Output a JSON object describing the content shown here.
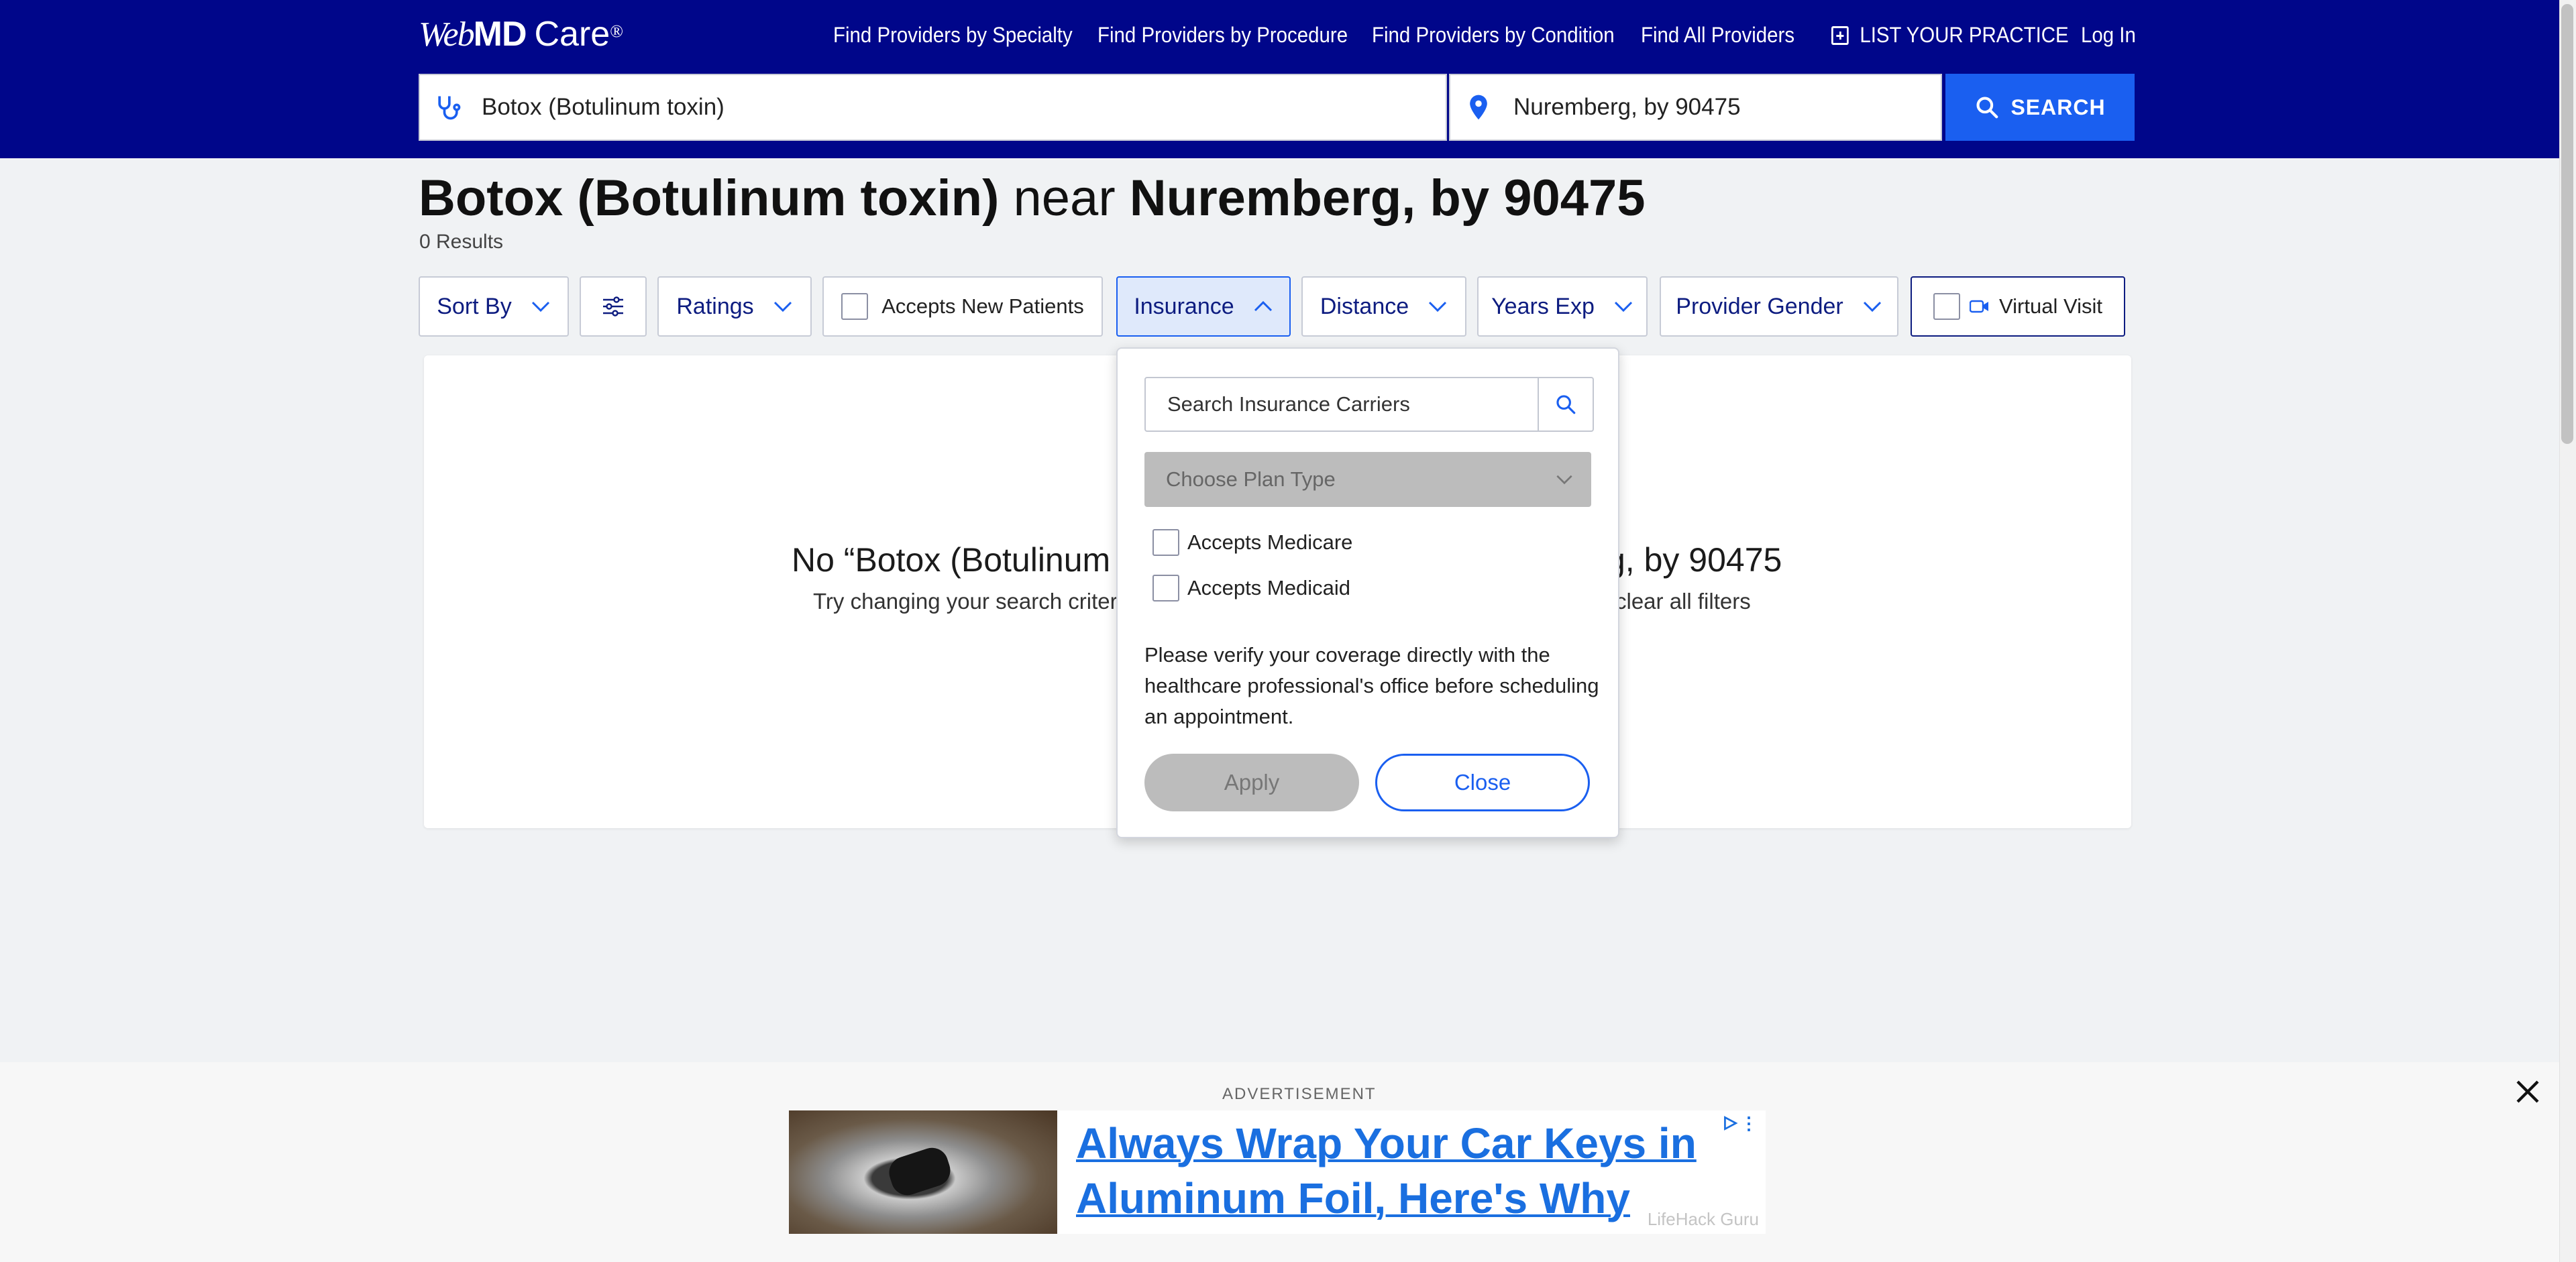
{
  "header": {
    "logo": {
      "web": "Web",
      "md": "MD",
      "care": "Care",
      "reg": "®"
    },
    "nav": [
      {
        "label": "Find Providers by Specialty"
      },
      {
        "label": "Find Providers by Procedure"
      },
      {
        "label": "Find Providers by Condition"
      },
      {
        "label": "Find All Providers"
      },
      {
        "label": "LIST YOUR PRACTICE"
      },
      {
        "label": "Log In"
      }
    ],
    "search": {
      "query_value": "Botox (Botulinum toxin)",
      "location_value": "Nuremberg, by 90475",
      "button_label": "SEARCH"
    }
  },
  "title": {
    "query": "Botox (Botulinum toxin)",
    "near": "near",
    "location": "Nuremberg, by 90475"
  },
  "results_count": "0 Results",
  "filters": {
    "sort_by": "Sort By",
    "ratings": "Ratings",
    "accepts_new_patients": "Accepts New Patients",
    "insurance": "Insurance",
    "distance": "Distance",
    "years_exp": "Years Exp",
    "provider_gender": "Provider Gender",
    "virtual_visit": "Virtual Visit"
  },
  "empty_state": {
    "title_left": "No “Botox (Botulinum to",
    "title_right": "g, by 90475",
    "sub_left": "Try changing your search criteria,",
    "sub_right": "clear all filters"
  },
  "insurance_dropdown": {
    "search_placeholder": "Search Insurance Carriers",
    "plan_type_placeholder": "Choose Plan Type",
    "accepts_medicare": "Accepts Medicare",
    "accepts_medicaid": "Accepts Medicaid",
    "note": "Please verify your coverage directly with the healthcare professional's office before scheduling an appointment.",
    "apply_label": "Apply",
    "close_label": "Close"
  },
  "ad": {
    "label": "ADVERTISEMENT",
    "headline": "Always Wrap Your Car Keys in Aluminum Foil, Here's Why",
    "source": "LifeHack Guru"
  },
  "colors": {
    "header_bg": "#00068a",
    "accent": "#1a5ff0",
    "filter_text": "#0d1c80"
  }
}
